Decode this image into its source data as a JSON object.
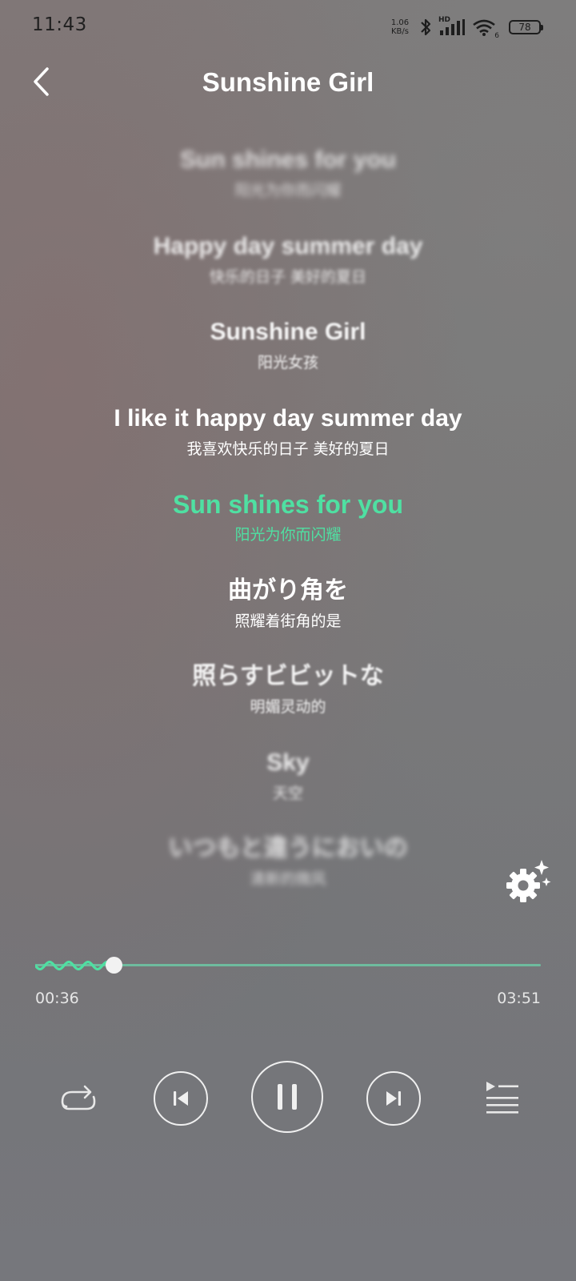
{
  "status_bar": {
    "time": "11:43",
    "net_speed_value": "1.06",
    "net_speed_unit": "KB/s",
    "network_label": "HD",
    "wifi_label": "6",
    "battery": "78"
  },
  "header": {
    "title": "Sunshine Girl"
  },
  "lyrics": [
    {
      "original": "Sun shines for you",
      "translation": "阳光为你而闪耀"
    },
    {
      "original": "Happy day summer day",
      "translation": "快乐的日子 美好的夏日"
    },
    {
      "original": "Sunshine Girl",
      "translation": "阳光女孩"
    },
    {
      "original": "I like it happy day summer day",
      "translation": "我喜欢快乐的日子 美好的夏日"
    },
    {
      "original": "Sun shines for you",
      "translation": "阳光为你而闪耀"
    },
    {
      "original": "曲がり角を",
      "translation": "照耀着街角的是"
    },
    {
      "original": "照らすビビットな",
      "translation": "明媚灵动的"
    },
    {
      "original": "Sky",
      "translation": "天空"
    },
    {
      "original": "いつもと違うにおいの",
      "translation": "清新的微风"
    }
  ],
  "current_lyric_index": 4,
  "player": {
    "elapsed": "00:36",
    "duration": "03:51",
    "progress_fraction": 0.156
  },
  "colors": {
    "accent": "#4fe0a2",
    "text": "#ffffff"
  },
  "icons": {
    "back": "chevron-left-icon",
    "settings": "gear-sparkle-icon",
    "repeat": "repeat-icon",
    "previous": "skip-previous-icon",
    "pause": "pause-icon",
    "next": "skip-next-icon",
    "queue": "playlist-icon"
  }
}
